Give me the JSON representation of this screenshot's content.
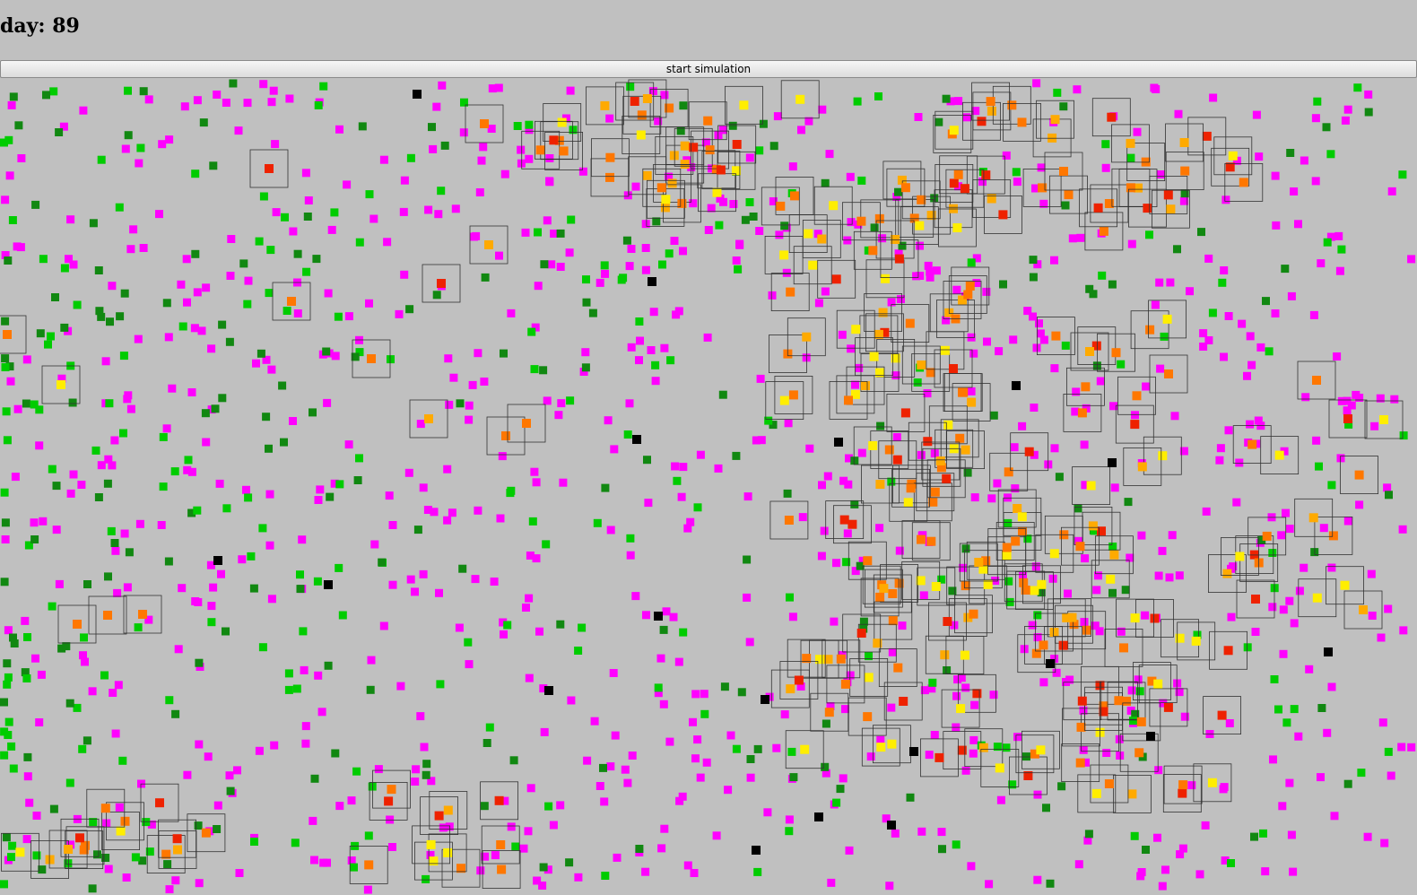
{
  "header": {
    "day_label": "day:",
    "day_value": "89"
  },
  "controls": {
    "start_button_label": "start simulation"
  },
  "colors": {
    "background": "#c0c0c0",
    "susceptible": "#ff00ff",
    "healthy_light": "#00cc00",
    "healthy_dark": "#118811",
    "infected_red": "#ee2200",
    "infected_orange": "#ff7700",
    "infected_amber": "#ffaa00",
    "infected_yellow": "#ffee00",
    "dead": "#000000",
    "infection_zone_stroke": "#333333"
  },
  "legend_icons": {
    "agent_icon": "square-agent-icon",
    "zone_icon": "infection-radius-square-icon"
  }
}
